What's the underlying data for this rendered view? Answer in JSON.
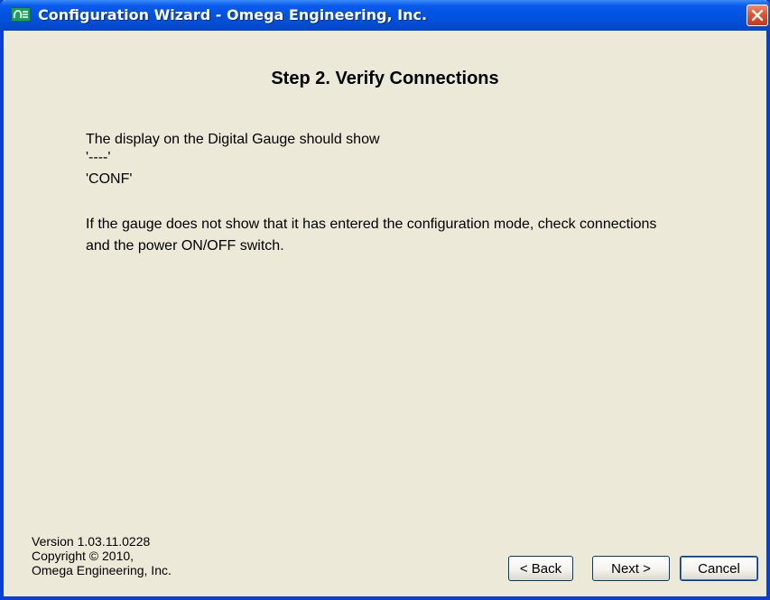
{
  "window": {
    "title": "Configuration Wizard - Omega Engineering, Inc.",
    "app_icon_label": "OE",
    "close_symbol": "✕"
  },
  "main": {
    "heading": "Step 2.  Verify Connections",
    "line1": "The display on the Digital Gauge should show",
    "line2": "'----'",
    "line3": "'CONF'",
    "paragraph": "If the gauge does not show that it has entered the configuration mode, check connections and the power ON/OFF switch."
  },
  "footer": {
    "version": "Version 1.03.11.0228",
    "copyright": "Copyright © 2010,",
    "company": "Omega Engineering, Inc.",
    "back_label": "< Back",
    "next_label": "Next >",
    "cancel_label": "Cancel"
  },
  "colors": {
    "titlebar": "#0054e3",
    "window_bg": "#ece9d8",
    "close_button": "#e2542c"
  }
}
